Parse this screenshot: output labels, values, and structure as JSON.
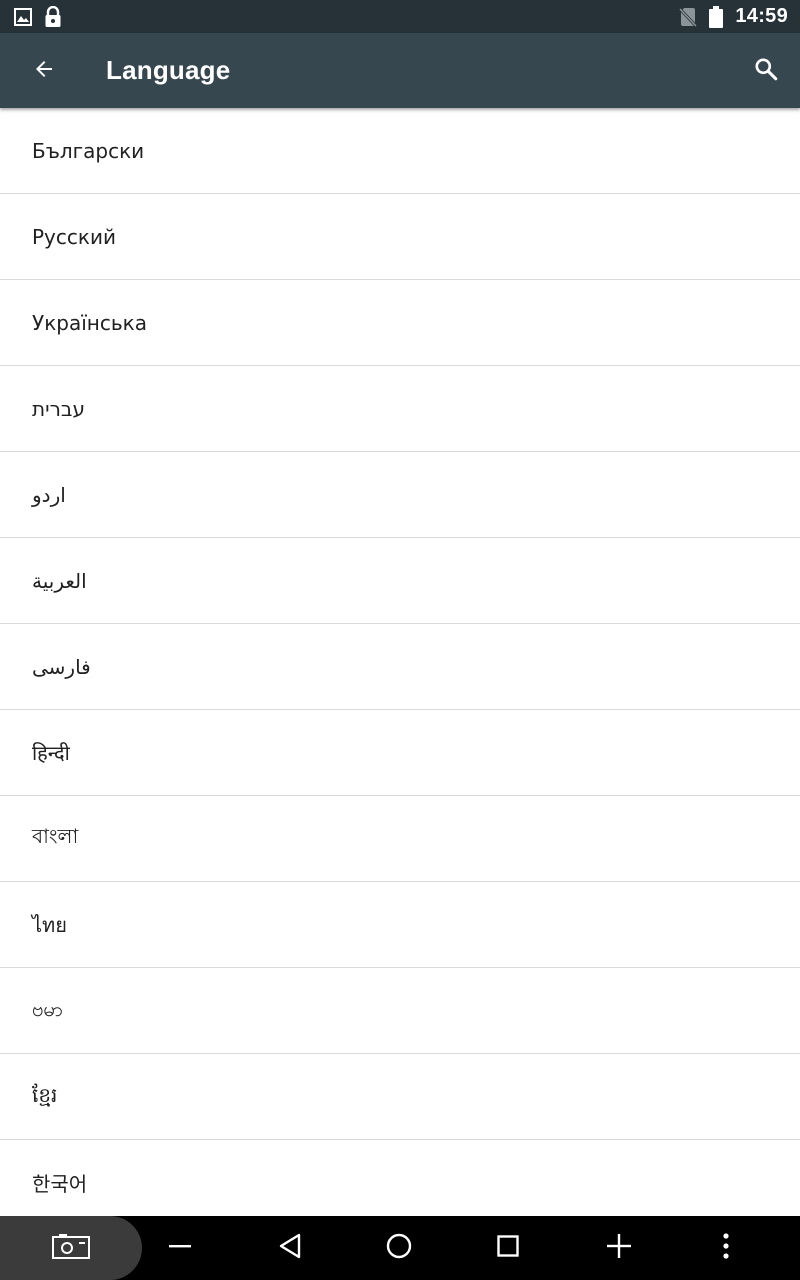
{
  "status_bar": {
    "time": "14:59",
    "icons_left": [
      "image-icon",
      "lock-icon"
    ],
    "icons_right": [
      "no-sim-icon",
      "battery-icon"
    ]
  },
  "app_bar": {
    "title": "Language",
    "back_icon": "arrow-back-icon",
    "search_icon": "search-icon",
    "background": "#37474f"
  },
  "languages": [
    "Български",
    "Русский",
    "Українська",
    "עברית",
    "اردو",
    "العربية",
    "فارسی",
    "हिन्दी",
    "বাংলা",
    "ไทย",
    "ဗမာ",
    "ខ្មែរ",
    "한국어"
  ],
  "nav_bar": {
    "buttons": [
      "screenshot-icon",
      "volume-down-icon",
      "back-triangle-icon",
      "home-circle-icon",
      "recents-square-icon",
      "volume-up-icon",
      "more-vert-icon"
    ]
  }
}
